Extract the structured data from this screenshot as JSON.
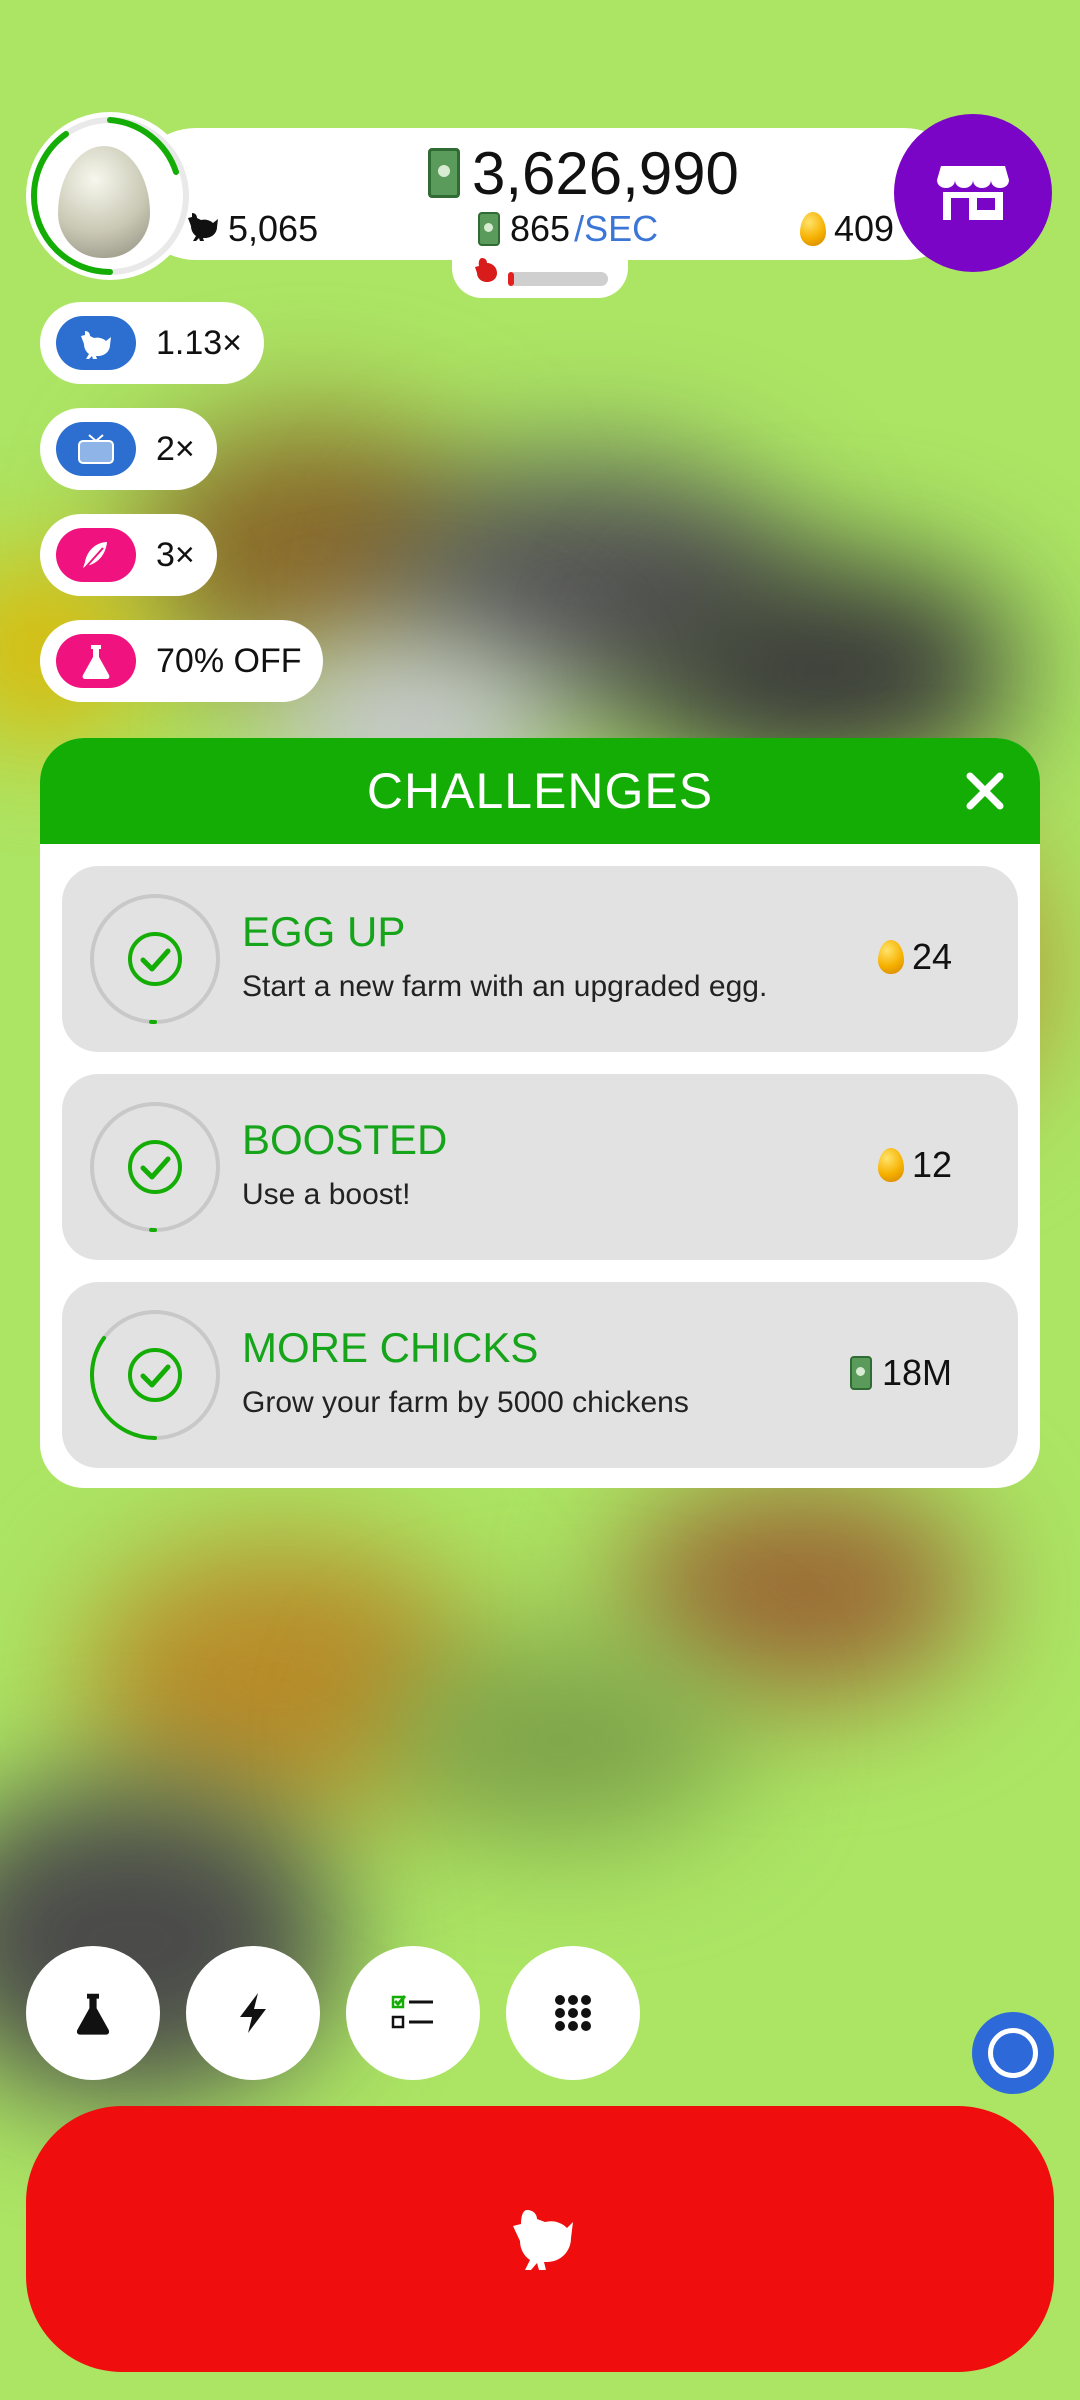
{
  "header": {
    "money": "3,626,990",
    "chicken_count": "5,065",
    "income_rate": "865",
    "income_unit": "/SEC",
    "golden_eggs": "409",
    "hatch_progress": 0.05
  },
  "boosts": [
    {
      "icon": "chicken-icon",
      "label": "1.13×",
      "color": "#2d6fd1"
    },
    {
      "icon": "tv-icon",
      "label": "2×",
      "color": "#2d6fd1"
    },
    {
      "icon": "feather-icon",
      "label": "3×",
      "color": "#f0127f"
    },
    {
      "icon": "flask-icon",
      "label": "70% OFF",
      "color": "#f0127f"
    }
  ],
  "challenges": {
    "title": "CHALLENGES",
    "items": [
      {
        "title": "EGG UP",
        "desc": "Start a new farm with an upgraded egg.",
        "reward": "24",
        "reward_icon": "golden-egg-icon",
        "progress": 0.01
      },
      {
        "title": "BOOSTED",
        "desc": "Use a boost!",
        "reward": "12",
        "reward_icon": "golden-egg-icon",
        "progress": 0.01
      },
      {
        "title": "MORE CHICKS",
        "desc": "Grow your farm by 5000 chickens",
        "reward": "18M",
        "reward_icon": "cash-icon",
        "progress": 0.35
      }
    ]
  },
  "bottom_nav": [
    {
      "icon": "flask-icon"
    },
    {
      "icon": "lightning-icon"
    },
    {
      "icon": "checklist-icon"
    },
    {
      "icon": "grid-icon"
    }
  ],
  "colors": {
    "accent_green": "#14ad05",
    "shop_purple": "#7a05c7",
    "hatch_red": "#ef0d0d"
  }
}
